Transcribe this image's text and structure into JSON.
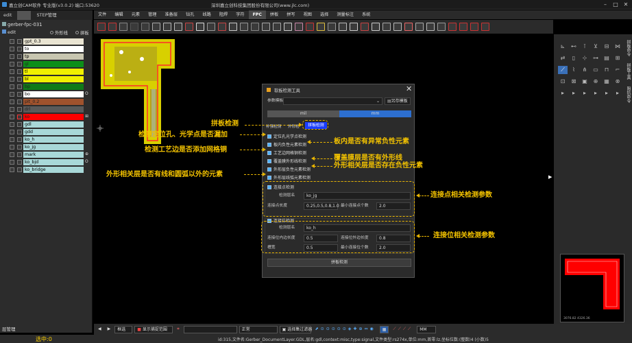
{
  "window": {
    "title": "嘉立创CAM软件 专业版(v3.0.2) 端口:53620",
    "center_title": "深圳嘉立创科技集团股份有限公司(www.jlc.com)"
  },
  "menu": [
    "文件",
    "编辑",
    "元素",
    "管理",
    "准备层",
    "钻孔",
    "线路",
    "阻焊",
    "字符",
    "FPC",
    "拼板",
    "拼写",
    "视图",
    "选择",
    "测量标注",
    "系统"
  ],
  "menu_active_index": 9,
  "leftpanel": {
    "tabs": [
      "edit",
      "STEP管理"
    ],
    "job": "gerber-fpc-031",
    "step": "edit",
    "col_outline": "外形线",
    "col_panel": "拼板",
    "layers": [
      {
        "name": "gpt_0.3",
        "color": "#e9e4d2",
        "mark": ""
      },
      {
        "name": "to",
        "color": "#ffffff",
        "mark": ""
      },
      {
        "name": "tp",
        "color": "#c8c6b0",
        "mark": ""
      },
      {
        "name": "gl",
        "color": "#0c8f19",
        "mark": ""
      },
      {
        "name": "tl",
        "color": "#f0f000",
        "mark": ""
      },
      {
        "name": "bl",
        "color": "#f0f000",
        "mark": ""
      },
      {
        "name": "bp",
        "color": "#0f7a18",
        "mark": ""
      },
      {
        "name": "bo",
        "color": "#ffffff",
        "mark": "O"
      },
      {
        "name": "plt_0.2",
        "color": "#a0522d",
        "mark": ""
      },
      {
        "name": "drl",
        "color": "#5a5a5a",
        "mark": ""
      },
      {
        "name": "ko",
        "color": "#ff0000",
        "mark": "⊞"
      },
      {
        "name": "gdl",
        "color": "#a8d8d8",
        "mark": ""
      },
      {
        "name": "gdd",
        "color": "#a8d8d8",
        "mark": ""
      },
      {
        "name": "ko_h",
        "color": "#a8d8d8",
        "mark": ""
      },
      {
        "name": "ko_jg",
        "color": "#a8d8d8",
        "mark": ""
      },
      {
        "name": "mark",
        "color": "#a8d8d8",
        "mark": "⊕"
      },
      {
        "name": "ko_bjd",
        "color": "#a8d8d8",
        "mark": "O"
      },
      {
        "name": "ko_bridge",
        "color": "#a8d8d8",
        "mark": ""
      }
    ],
    "layer_mgr": "层管理",
    "selected": "选中:0"
  },
  "dialog": {
    "title": "软板检测工具",
    "param_label": "参数模板",
    "save_template": "另存模板",
    "unit_mil": "mil",
    "unit_mm": "mm",
    "tabs": [
      "补强检测",
      "外形检",
      "拼板检测"
    ],
    "checks": [
      "定位孔光学点检测",
      "板内负性元素检测",
      "工艺边网格铜检测",
      "覆盖膜外形线检测",
      "外形层负性元素检测",
      "外形层线弧元素检测"
    ],
    "conn_point": {
      "title": "连接点检测",
      "name_label": "检测层名",
      "name_value": "ko_jg",
      "len_label": "连接点长度",
      "len_value": "0.25,0.5,0.8,1.0",
      "min_label": "最小连接点个数",
      "min_value": "2.0"
    },
    "conn_pos": {
      "title": "连接位检测",
      "name_label": "检测层名",
      "name_value": "ko_h",
      "inner_label": "连接位内边长度",
      "inner_value": "0.5",
      "outer_label": "连接位外边长度",
      "outer_value": "0.8",
      "gap_label": "槽宽",
      "gap_value": "0.5",
      "min_label": "最小连接位个数",
      "min_value": "2.0"
    },
    "run_button": "拼板检测"
  },
  "annotations": {
    "panel_check": "拼板检测",
    "left1": "检测定位孔、光学点是否漏加",
    "left2": "检测工艺边是否添加网格铜",
    "left3": "外形相关层是否有线和圆弧以外的元素",
    "right1": "板内是否有异常负性元素",
    "right2": "覆盖膜层是否有外形线",
    "right3": "外形相关层是否存在负性元素",
    "right4": "连接点相关检测参数",
    "right5": "连接位相关检测参数"
  },
  "rightpanel": {
    "tabs": [
      "拼板命令",
      "拼板工具",
      "阻抗命令"
    ]
  },
  "bottom": {
    "mode": "框选",
    "snap": "显示捕捉范围",
    "linemode": "正常",
    "filter": "选择集过滤器",
    "unit": "MM",
    "coords": "3076.82  4326.36"
  },
  "status": "id:315,文件名:Gerber_DocumentLayer.GDL,层名:gdl,context:misc,type:signal,文件类型:rs274x,单位:mm,首零:lz,坐标位数:(整数)4 (小数)5"
}
